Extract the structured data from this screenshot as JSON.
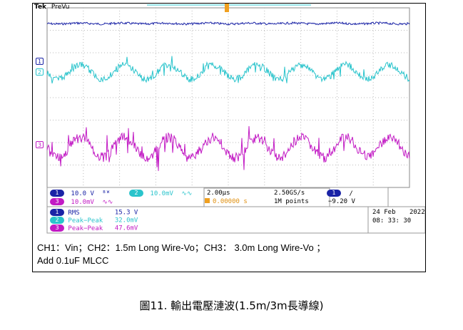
{
  "scope": {
    "brand": "Tek",
    "state": "PreVu",
    "channels": [
      {
        "id": "1",
        "color": "#1a23a6"
      },
      {
        "id": "2",
        "color": "#2ac4cc"
      },
      {
        "id": "3",
        "color": "#c21ac4"
      }
    ],
    "settings_left": [
      {
        "ch": "1",
        "value": "10.0 V",
        "coupling": "bw-icon"
      },
      {
        "ch": "2",
        "value": "10.0mV",
        "coupling": "bw-icon"
      },
      {
        "ch": "3",
        "value": "10.0mV",
        "coupling": "bw-icon"
      }
    ],
    "timebase": "2.00µs",
    "sample_rate": "2.50GS/s",
    "trigger_offset": "0.00000 s",
    "record_length": "1M points",
    "trigger_channel": "1",
    "trigger_slope": "/",
    "trigger_level": "−9.20 V",
    "measurements": [
      {
        "ch": "1",
        "name": "RMS",
        "value": "15.3 V"
      },
      {
        "ch": "2",
        "name": "Peak−Peak",
        "value": "32.0mV"
      },
      {
        "ch": "3",
        "name": "Peak−Peak",
        "value": "47.6mV"
      }
    ],
    "date": "24 Feb",
    "year": "2022",
    "time": "08: 33: 30"
  },
  "caption": {
    "line1": "CH1：Vin；CH2：1.5m Long Wire-Vo；CH3： 3.0m Long Wire-Vo ；",
    "line2": "Add 0.1uF MLCC"
  },
  "figure_title": "圖11. 輸出電壓漣波(1.5m/3m長導線)"
}
